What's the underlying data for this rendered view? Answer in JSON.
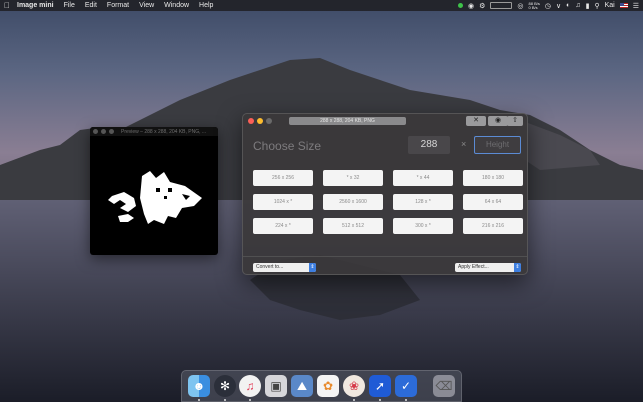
{
  "menubar": {
    "apple_icon": "apple-icon",
    "app_name": "Image mini",
    "menus": [
      "File",
      "Edit",
      "Format",
      "View",
      "Window",
      "Help"
    ],
    "network_up": "88 B/s",
    "network_down": "0 B/s",
    "user": "Kai",
    "status_color": "#3ec24a"
  },
  "preview": {
    "title": "Preview – 288 x 288, 204 KB, PNG, ..."
  },
  "window": {
    "title": "288 x 288, 204 KB, PNG",
    "heading": "Choose Size",
    "width_value": "288",
    "times_symbol": "×",
    "height_placeholder": "Height",
    "presets": [
      "256 x 256",
      "* x 32",
      "* x 44",
      "180 x 180",
      "1024 x *",
      "2560 x 1600",
      "128 x *",
      "64 x 64",
      "224 x *",
      "512 x 512",
      "300 x *",
      "216 x 216"
    ],
    "convert_label": "Convert to...",
    "apply_label": "Apply Effect...",
    "accent_color": "#3d7ee0"
  },
  "dock": {
    "apps": [
      {
        "name": "finder-icon"
      },
      {
        "name": "safari-icon"
      },
      {
        "name": "music-icon"
      },
      {
        "name": "preview-icon"
      },
      {
        "name": "photo-viewer-icon"
      },
      {
        "name": "photos-icon"
      },
      {
        "name": "image-mini-icon"
      },
      {
        "name": "stocks-icon"
      },
      {
        "name": "task-icon"
      },
      {
        "name": "trash-icon"
      }
    ]
  }
}
